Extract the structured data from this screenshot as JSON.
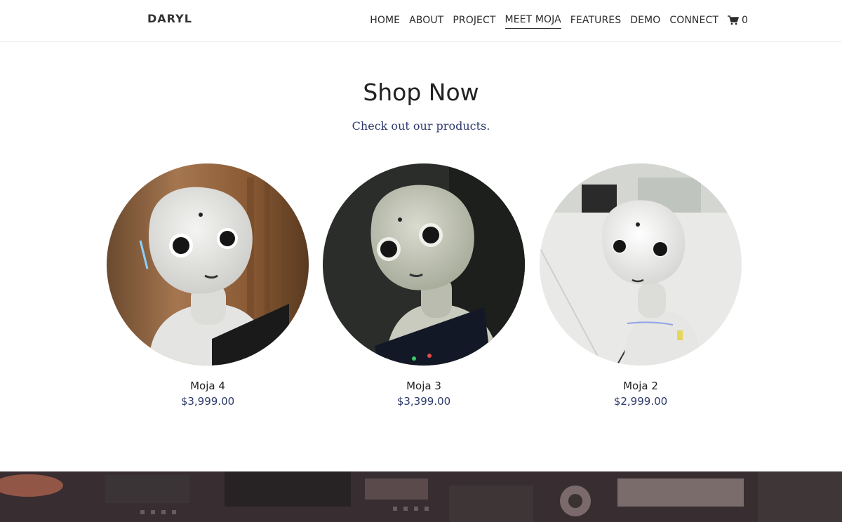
{
  "brand": "DARYL",
  "nav": {
    "items": [
      {
        "label": "HOME",
        "name": "nav-home"
      },
      {
        "label": "ABOUT",
        "name": "nav-about"
      },
      {
        "label": "PROJECT",
        "name": "nav-project"
      },
      {
        "label": "MEET MOJA",
        "name": "nav-meet-moja",
        "active": true
      },
      {
        "label": "FEATURES",
        "name": "nav-features"
      },
      {
        "label": "DEMO",
        "name": "nav-demo"
      },
      {
        "label": "CONNECT",
        "name": "nav-connect"
      }
    ],
    "cart_icon": "cart-icon",
    "cart_count": "0"
  },
  "shop": {
    "title": "Shop Now",
    "subtitle": "Check out our products."
  },
  "products": [
    {
      "name": "Moja 4",
      "price": "$3,999.00"
    },
    {
      "name": "Moja 3",
      "price": "$3,399.00"
    },
    {
      "name": "Moja 2",
      "price": "$2,999.00"
    }
  ],
  "colors": {
    "accent": "#2c3a6b",
    "text": "#222222",
    "header_border": "#ececec"
  }
}
